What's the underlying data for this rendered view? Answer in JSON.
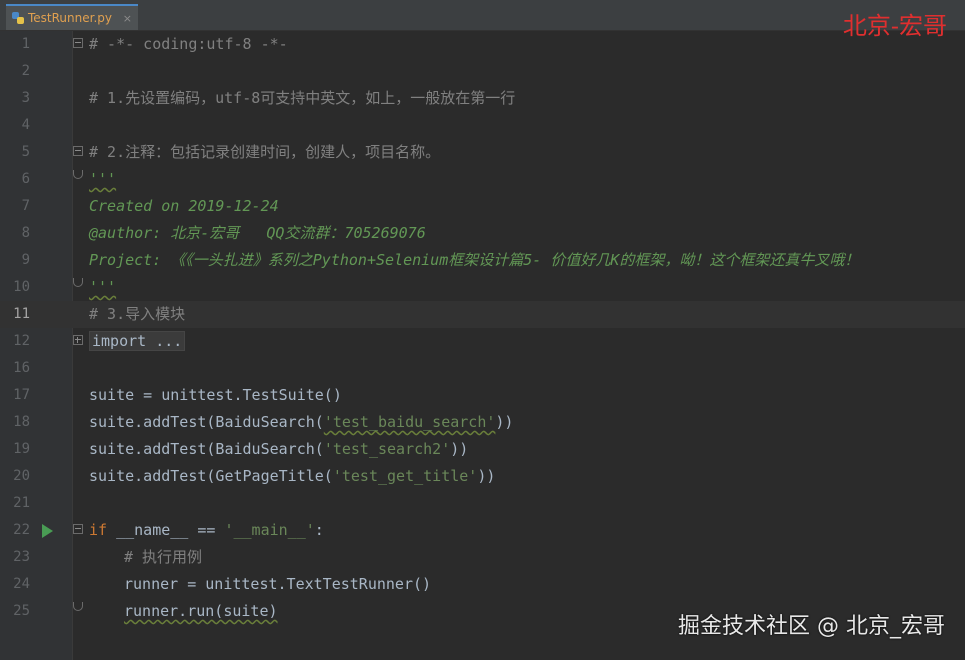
{
  "tab": {
    "filename": "TestRunner.py",
    "close": "×"
  },
  "watermark": {
    "top": "北京-宏哥",
    "bottom": "掘金技术社区 @ 北京_宏哥"
  },
  "colors": {
    "comment": "#808080",
    "docstring": "#629755",
    "keyword": "#cc7832",
    "string": "#6a8759",
    "default": "#a9b7c6",
    "watermark_top": "#e02f2f"
  },
  "editor": {
    "caret_line": "11",
    "lines": [
      {
        "num": "1",
        "text": "# -*- coding:utf-8 -*-"
      },
      {
        "num": "2",
        "text": ""
      },
      {
        "num": "3",
        "text": "# 1.先设置编码，utf-8可支持中英文，如上，一般放在第一行"
      },
      {
        "num": "4",
        "text": ""
      },
      {
        "num": "5",
        "text": "# 2.注释：包括记录创建时间，创建人，项目名称。"
      },
      {
        "num": "6",
        "text": "'''"
      },
      {
        "num": "7",
        "text": "Created on 2019-12-24"
      },
      {
        "num": "8",
        "text": "@author: 北京-宏哥   QQ交流群：705269076"
      },
      {
        "num": "9",
        "text": "Project: 《《一头扎进》系列之Python+Selenium框架设计篇5- 价值好几K的框架，呦！这个框架还真牛叉哦！"
      },
      {
        "num": "10",
        "text": "'''"
      },
      {
        "num": "11",
        "text": "# 3.导入模块"
      },
      {
        "num": "12",
        "text": "import ..."
      },
      {
        "num": "16",
        "text": ""
      },
      {
        "num": "17",
        "text": "suite = unittest.TestSuite()"
      },
      {
        "num": "18",
        "parts": [
          "suite.addTest(BaiduSearch(",
          "'test_baidu_search'",
          "))"
        ]
      },
      {
        "num": "19",
        "parts": [
          "suite.addTest(BaiduSearch(",
          "'test_search2'",
          "))"
        ]
      },
      {
        "num": "20",
        "parts": [
          "suite.addTest(GetPageTitle(",
          "'test_get_title'",
          "))"
        ]
      },
      {
        "num": "21",
        "text": ""
      },
      {
        "num": "22",
        "parts": [
          "if",
          " __name__ == ",
          "'__main__'",
          ":"
        ]
      },
      {
        "num": "23",
        "text": "# 执行用例"
      },
      {
        "num": "24",
        "text": "runner = unittest.TextTestRunner()"
      },
      {
        "num": "25",
        "text": "runner.run(suite)"
      }
    ]
  }
}
